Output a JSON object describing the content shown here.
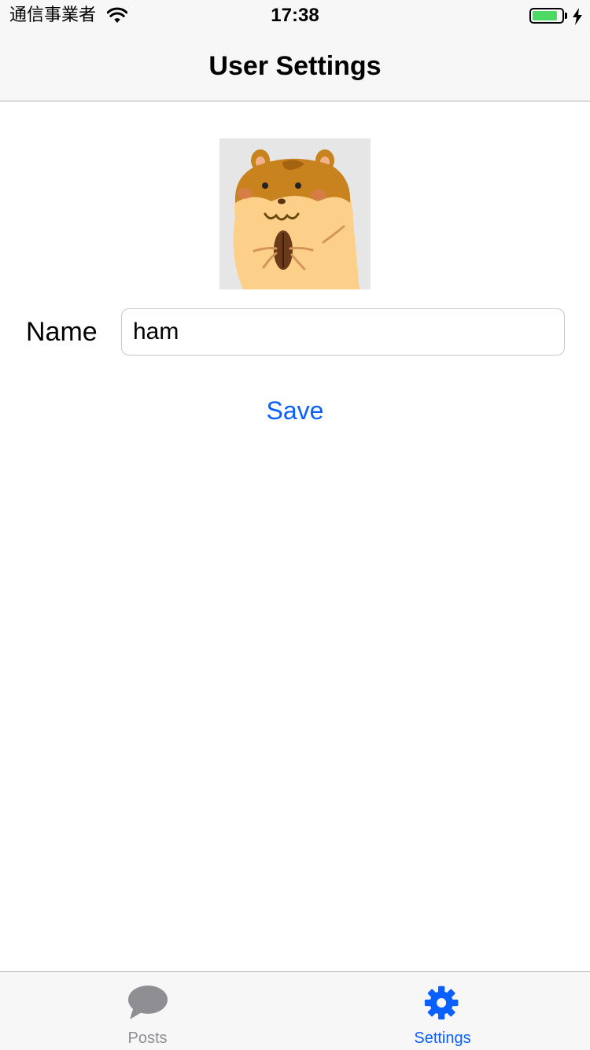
{
  "status_bar": {
    "carrier": "通信事業者",
    "time": "17:38",
    "battery_level": 0.85
  },
  "nav": {
    "title": "User Settings"
  },
  "profile": {
    "avatar": "hamster-illustration",
    "name_label": "Name",
    "name_value": "ham",
    "save_label": "Save"
  },
  "tab_bar": {
    "tabs": [
      {
        "label": "Posts",
        "icon": "speech-bubble-icon",
        "selected": false
      },
      {
        "label": "Settings",
        "icon": "gear-icon",
        "selected": true
      }
    ]
  },
  "colors": {
    "accent": "#0a60ff",
    "inactive_tab": "#8e8e93",
    "bar_background": "#f7f7f7",
    "battery_fill": "#4cd964"
  }
}
